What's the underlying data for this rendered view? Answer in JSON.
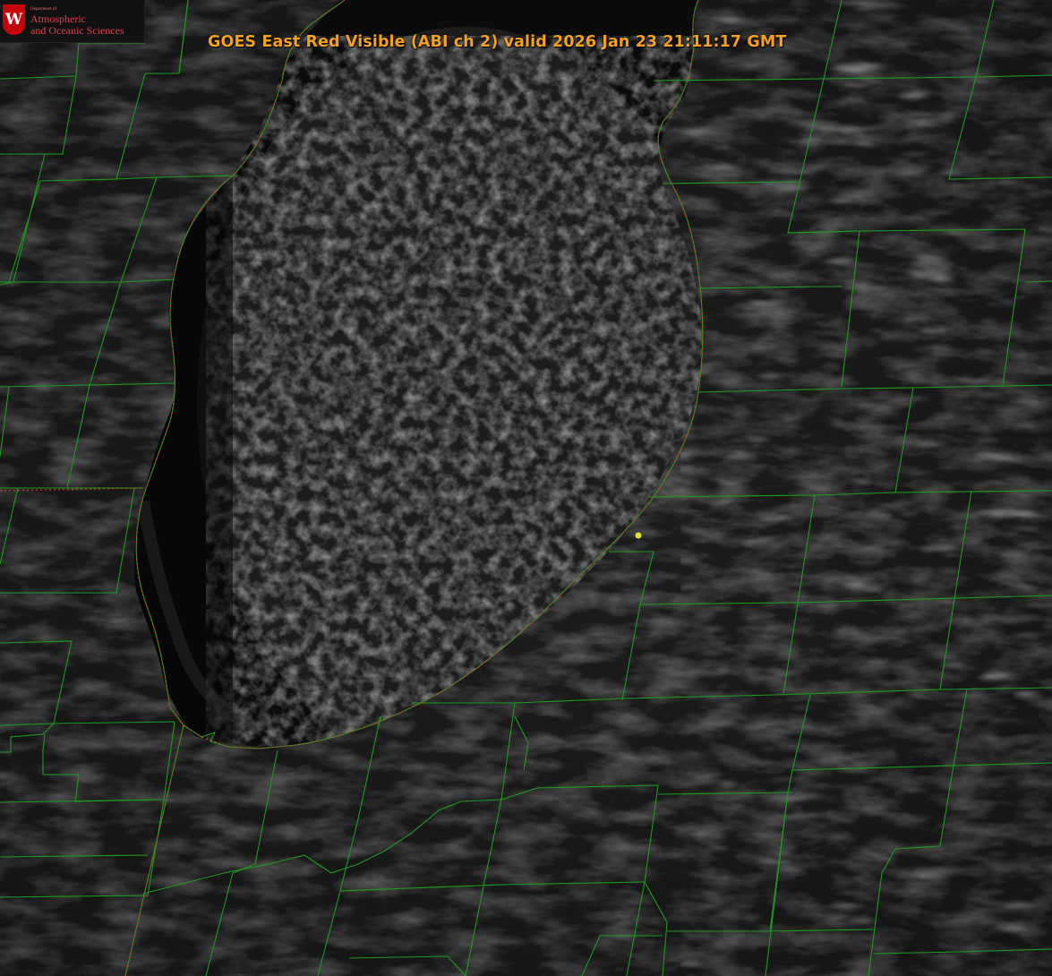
{
  "title": "GOES East Red Visible (ABI ch 2) valid 2026 Jan 23 21:11:17 GMT",
  "logo": {
    "crest_letter": "W",
    "department": "Department of",
    "line1": "Atmospheric",
    "line2": "and Oceanic Sciences",
    "brand_color": "#c5050c"
  },
  "colors": {
    "county_lines": "#1f9a1f",
    "state_border": "#c8452a",
    "title_text": "#f5a11e",
    "marker": "#e4e42a"
  },
  "icons": {
    "crest": "university-crest-icon",
    "marker": "location-marker-icon"
  }
}
